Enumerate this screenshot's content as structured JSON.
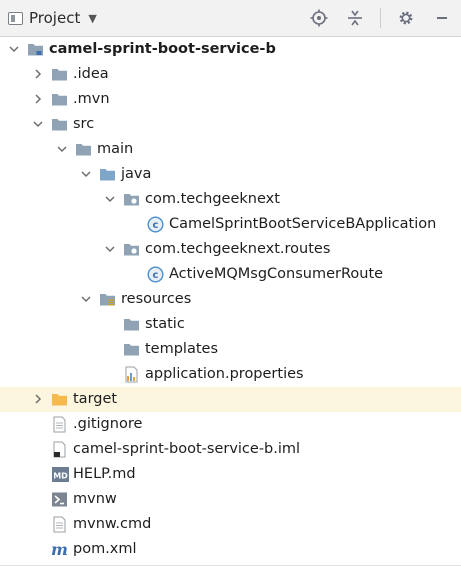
{
  "toolbar": {
    "title": "Project",
    "icons": [
      "locate-icon",
      "collapse-all-icon",
      "gear-icon",
      "minimize-icon"
    ]
  },
  "tree": [
    {
      "name": "camel-sprint-boot-service-b",
      "type": "module",
      "level": 0,
      "expanded": true,
      "bold": true
    },
    {
      "name": ".idea",
      "type": "folder",
      "level": 1,
      "expanded": false
    },
    {
      "name": ".mvn",
      "type": "folder",
      "level": 1,
      "expanded": false
    },
    {
      "name": "src",
      "type": "folder",
      "level": 1,
      "expanded": true
    },
    {
      "name": "main",
      "type": "folder",
      "level": 2,
      "expanded": true
    },
    {
      "name": "java",
      "type": "source-folder",
      "level": 3,
      "expanded": true
    },
    {
      "name": "com.techgeeknext",
      "type": "package",
      "level": 4,
      "expanded": true
    },
    {
      "name": "CamelSprintBootServiceBApplication",
      "type": "class",
      "level": 5
    },
    {
      "name": "com.techgeeknext.routes",
      "type": "package",
      "level": 4,
      "expanded": true
    },
    {
      "name": "ActiveMQMsgConsumerRoute",
      "type": "class",
      "level": 5
    },
    {
      "name": "resources",
      "type": "resources-folder",
      "level": 3,
      "expanded": true
    },
    {
      "name": "static",
      "type": "folder",
      "level": 4
    },
    {
      "name": "templates",
      "type": "folder",
      "level": 4
    },
    {
      "name": "application.properties",
      "type": "properties",
      "level": 4
    },
    {
      "name": "target",
      "type": "excluded-folder",
      "level": 1,
      "expanded": false,
      "highlight": true
    },
    {
      "name": ".gitignore",
      "type": "file",
      "level": 1
    },
    {
      "name": "camel-sprint-boot-service-b.iml",
      "type": "iml",
      "level": 1
    },
    {
      "name": "HELP.md",
      "type": "markdown",
      "level": 1
    },
    {
      "name": "mvnw",
      "type": "shell",
      "level": 1
    },
    {
      "name": "mvnw.cmd",
      "type": "file",
      "level": 1
    },
    {
      "name": "pom.xml",
      "type": "maven",
      "level": 1
    }
  ],
  "colors": {
    "folder": "#8fa3b5",
    "excluded_folder": "#f5b94e",
    "highlight_row": "#fdf6df",
    "class_icon": "#4a8fd0"
  }
}
